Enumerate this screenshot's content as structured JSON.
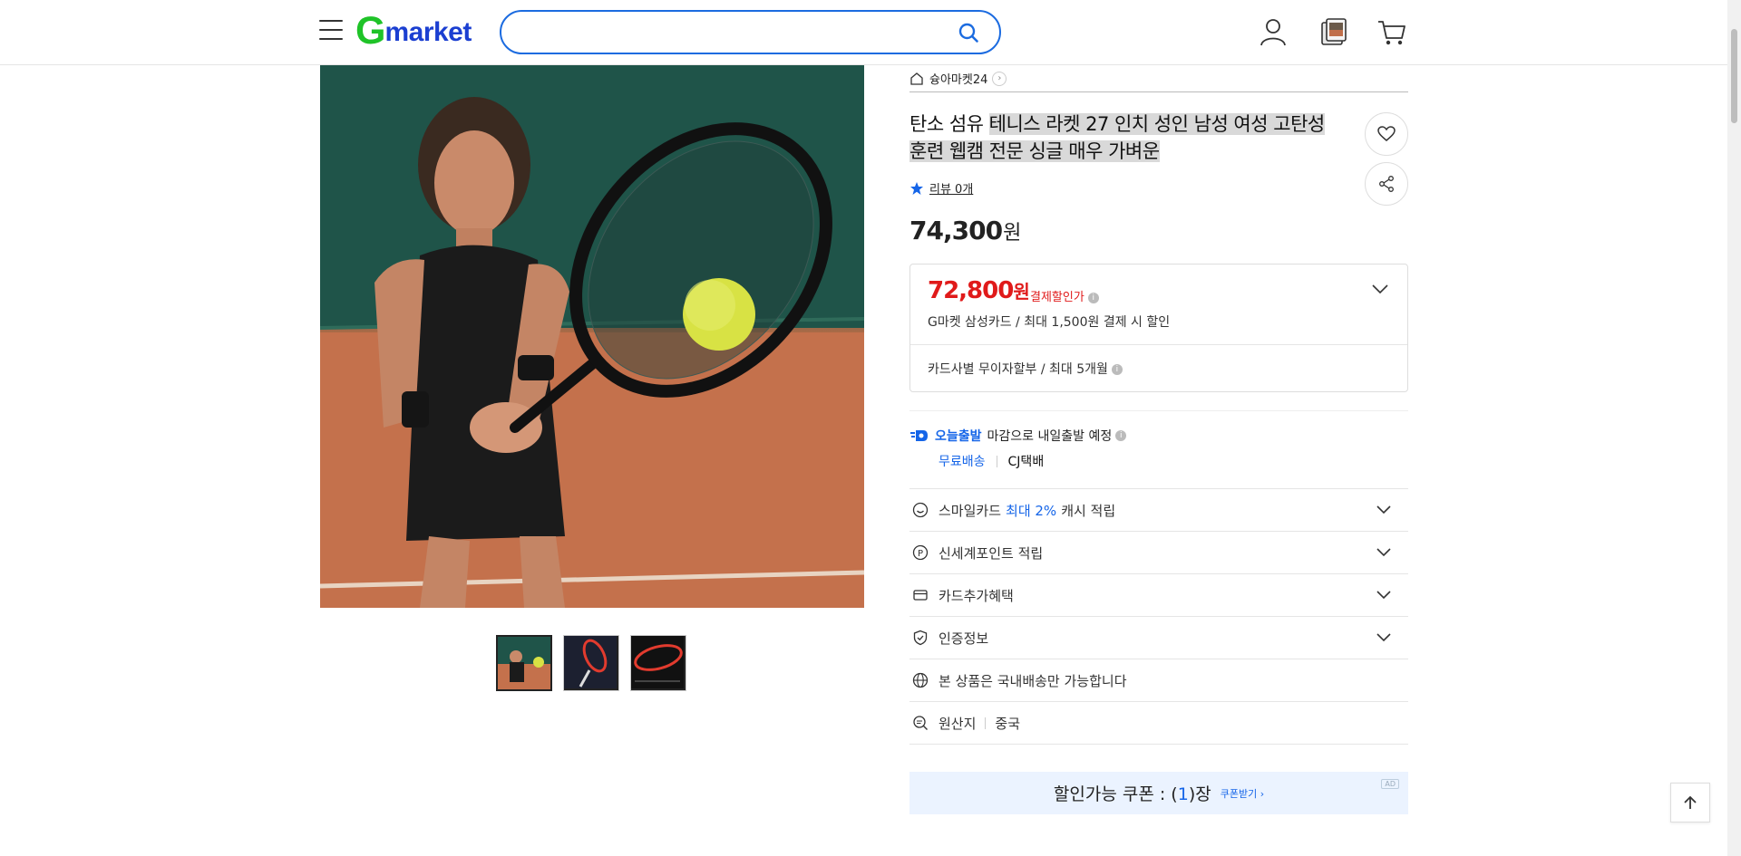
{
  "header": {
    "logo_g": "G",
    "logo_market": "market",
    "search": {
      "value": "",
      "placeholder": ""
    }
  },
  "seller": {
    "name": "슝아마켓24"
  },
  "product": {
    "title_plain": "탄소 섬유 ",
    "title_highlight_1": "테니스 라켓 27 인치 성인 남성 여성 고탄성",
    "title_highlight_2": "훈련 웹캠 전문 싱글 매우 가벼운",
    "review_label": "리뷰 0개",
    "price": "74,300",
    "price_unit": "원"
  },
  "discount": {
    "price": "72,800",
    "price_unit": "원",
    "label": "결제할인가",
    "sub": "G마켓 삼성카드 / 최대 1,500원 결제 시 할인",
    "installment": "카드사별 무이자할부 / 최대 5개월"
  },
  "shipping": {
    "today": "오늘출발",
    "today_rest": "마감으로 내일출발 예정",
    "free": "무료배송",
    "carrier": "CJ택배"
  },
  "rows": {
    "smile_pre": "스마일카드",
    "smile_blue": "최대 2%",
    "smile_post": "캐시 적립",
    "shinsegae": "신세계포인트 적립",
    "card_benefit": "카드추가혜택",
    "certification": "인증정보",
    "domestic": "본 상품은 국내배송만 가능합니다",
    "origin_label": "원산지",
    "origin_value": "중국"
  },
  "coupon": {
    "pre": "할인가능 쿠폰 : (",
    "count": "1",
    "post": ")장",
    "get": "쿠폰받기 ›",
    "ad": "AD"
  },
  "colors": {
    "brand_green": "#1fc328",
    "brand_blue": "#1b3fd1",
    "accent_blue": "#1565e8",
    "discount_red": "#e01a1a"
  }
}
